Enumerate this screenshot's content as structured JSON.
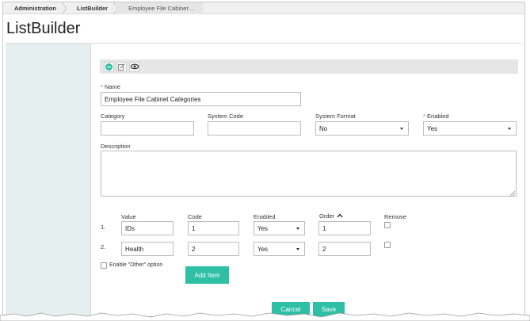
{
  "breadcrumb": {
    "items": [
      "Administration",
      "ListBuilder",
      "Employee File Cabinet ..."
    ]
  },
  "page": {
    "title": "ListBuilder"
  },
  "toolbar": {
    "icons": [
      "back-icon",
      "edit-icon",
      "view-icon"
    ]
  },
  "form": {
    "name_label": "Name",
    "name_value": "Employee File Cabinet Categories",
    "required_mark": "*",
    "category_label": "Category",
    "category_value": "",
    "system_code_label": "System Code",
    "system_code_value": "",
    "system_format_label": "System Format",
    "system_format_value": "No",
    "enabled_label": "Enabled",
    "enabled_value": "Yes",
    "description_label": "Description",
    "description_value": ""
  },
  "items_table": {
    "headers": {
      "value": "Value",
      "code": "Code",
      "enabled": "Enabled",
      "order": "Order",
      "remove": "Remove"
    },
    "rows": [
      {
        "num": "1.",
        "value": "IDs",
        "code": "1",
        "enabled": "Yes",
        "order": "1"
      },
      {
        "num": "2.",
        "value": "Health",
        "code": "2",
        "enabled": "Yes",
        "order": "2"
      }
    ],
    "other_option_label": "Enable \"Other\" option",
    "add_item_label": "Add Item"
  },
  "actions": {
    "cancel_label": "Cancel",
    "save_label": "Save"
  },
  "colors": {
    "accent": "#2ebfa5",
    "sidebar": "#e6eff0",
    "required": "#d9534f"
  }
}
